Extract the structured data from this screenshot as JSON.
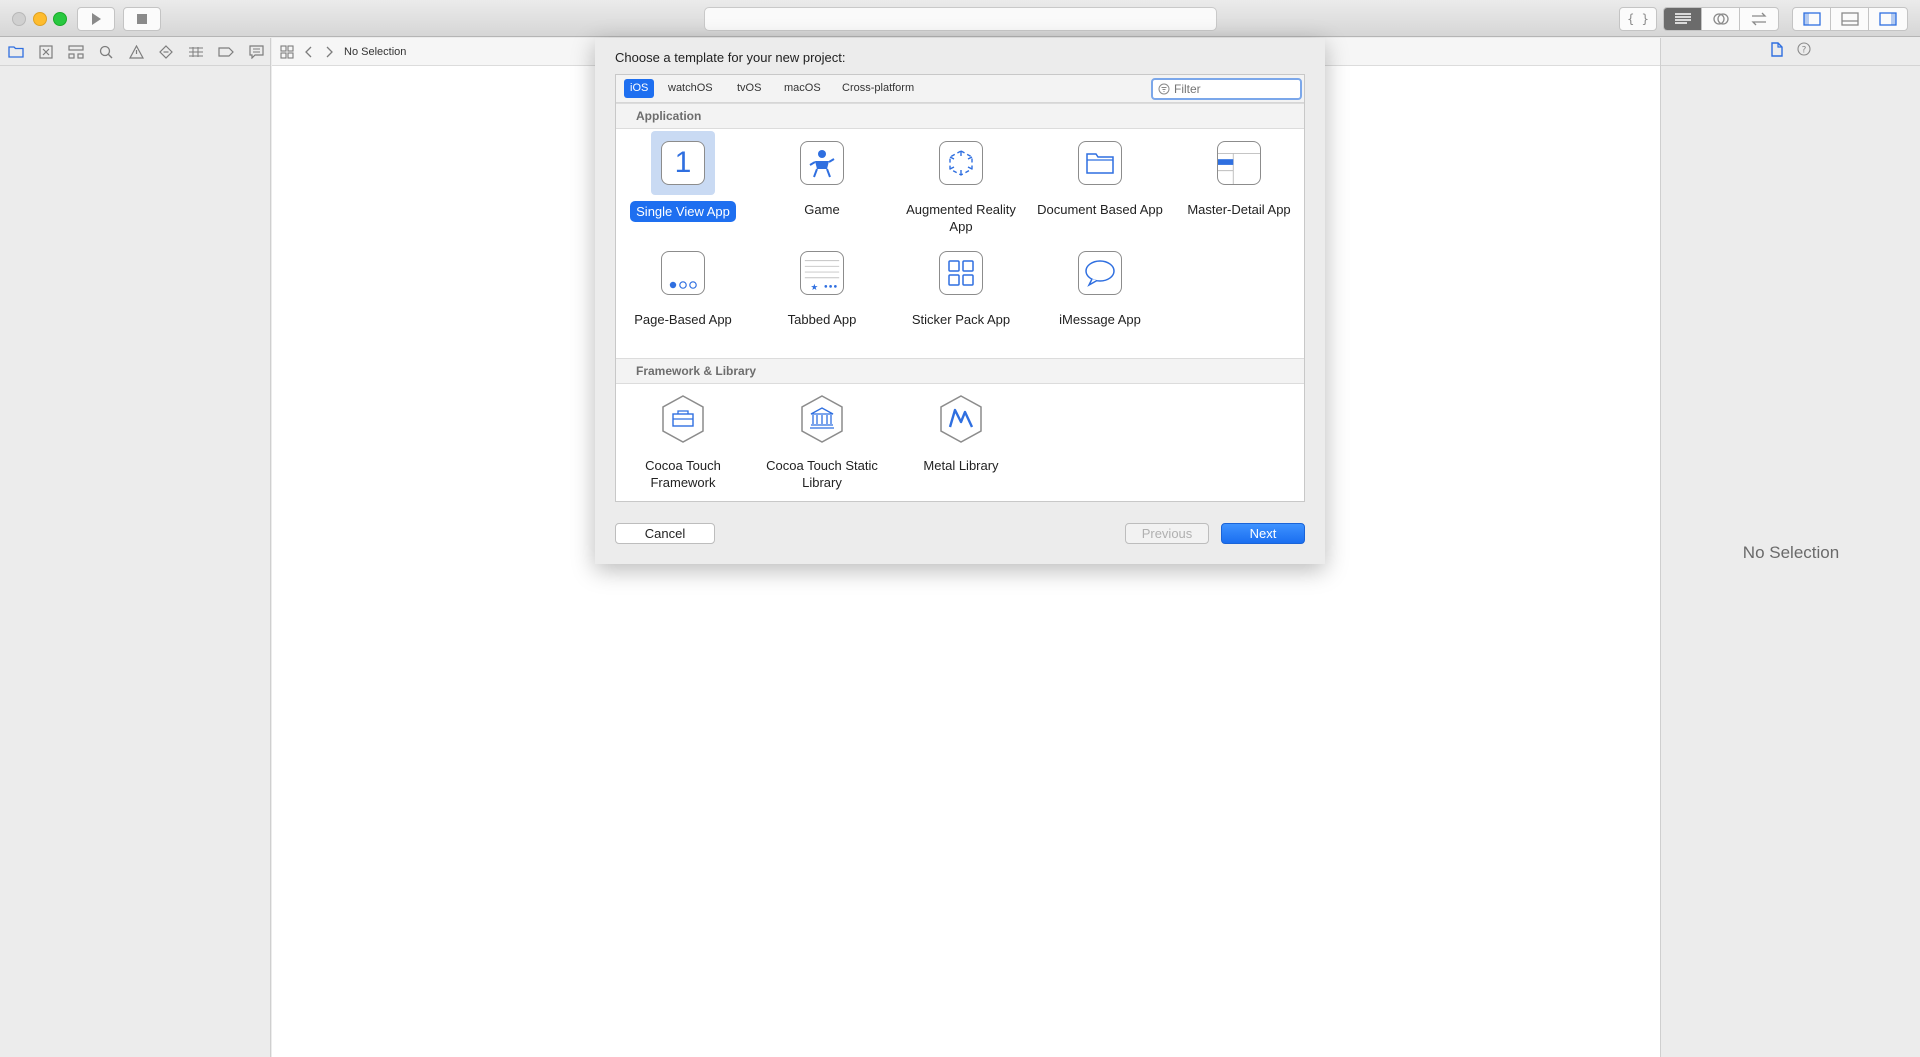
{
  "toolbar": {
    "run_icon": "play-icon",
    "stop_icon": "stop-icon",
    "activity_text": "",
    "editor_modes": [
      "standard-editor-icon",
      "assistant-editor-icon",
      "version-editor-icon"
    ],
    "view_toggles": [
      "navigator-toggle-icon",
      "debug-toggle-icon",
      "inspector-toggle-icon"
    ]
  },
  "navigator": {
    "tabs": [
      "folder-icon",
      "source-control-icon",
      "hierarchy-icon",
      "search-icon",
      "warning-icon",
      "test-icon",
      "debug-icon",
      "breakpoint-icon",
      "report-icon"
    ]
  },
  "jumpbar": {
    "label": "No Selection"
  },
  "inspector": {
    "no_selection": "No Selection"
  },
  "dialog": {
    "title": "Choose a template for your new project:",
    "platforms": [
      "iOS",
      "watchOS",
      "tvOS",
      "macOS",
      "Cross-platform"
    ],
    "selected_platform": "iOS",
    "filter_placeholder": "Filter",
    "sections": [
      {
        "name": "Application",
        "templates": [
          {
            "label": "Single View App",
            "icon": "single-view-icon",
            "selected": true
          },
          {
            "label": "Game",
            "icon": "game-icon"
          },
          {
            "label": "Augmented Reality App",
            "icon": "ar-icon"
          },
          {
            "label": "Document Based App",
            "icon": "document-icon"
          },
          {
            "label": "Master-Detail App",
            "icon": "master-detail-icon"
          },
          {
            "label": "Page-Based App",
            "icon": "page-based-icon"
          },
          {
            "label": "Tabbed App",
            "icon": "tabbed-icon"
          },
          {
            "label": "Sticker Pack App",
            "icon": "sticker-pack-icon"
          },
          {
            "label": "iMessage App",
            "icon": "imessage-icon"
          }
        ]
      },
      {
        "name": "Framework & Library",
        "templates": [
          {
            "label": "Cocoa Touch Framework",
            "icon": "framework-icon"
          },
          {
            "label": "Cocoa Touch Static Library",
            "icon": "static-library-icon"
          },
          {
            "label": "Metal Library",
            "icon": "metal-icon"
          }
        ]
      }
    ],
    "buttons": {
      "cancel": "Cancel",
      "previous": "Previous",
      "next": "Next"
    }
  },
  "colors": {
    "accent": "#1e6ff0",
    "icon_blue": "#2f6fe0"
  }
}
